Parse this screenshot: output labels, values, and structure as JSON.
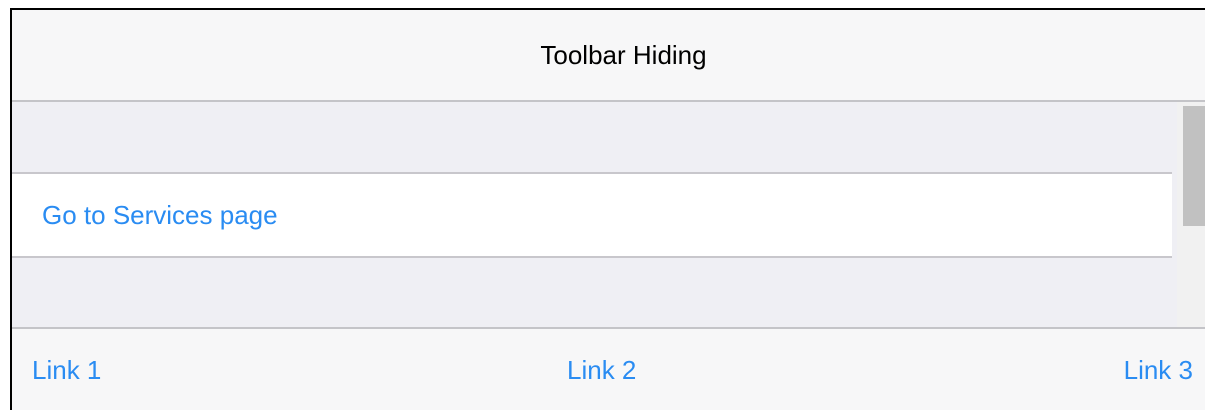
{
  "navbar": {
    "title": "Toolbar Hiding"
  },
  "content": {
    "list_link": "Go to Services page"
  },
  "toolbar": {
    "links": [
      "Link 1",
      "Link 2",
      "Link 3"
    ]
  },
  "colors": {
    "link": "#2a8cf2",
    "page_background": "#efeff4",
    "bar_background": "#f7f7f8"
  }
}
